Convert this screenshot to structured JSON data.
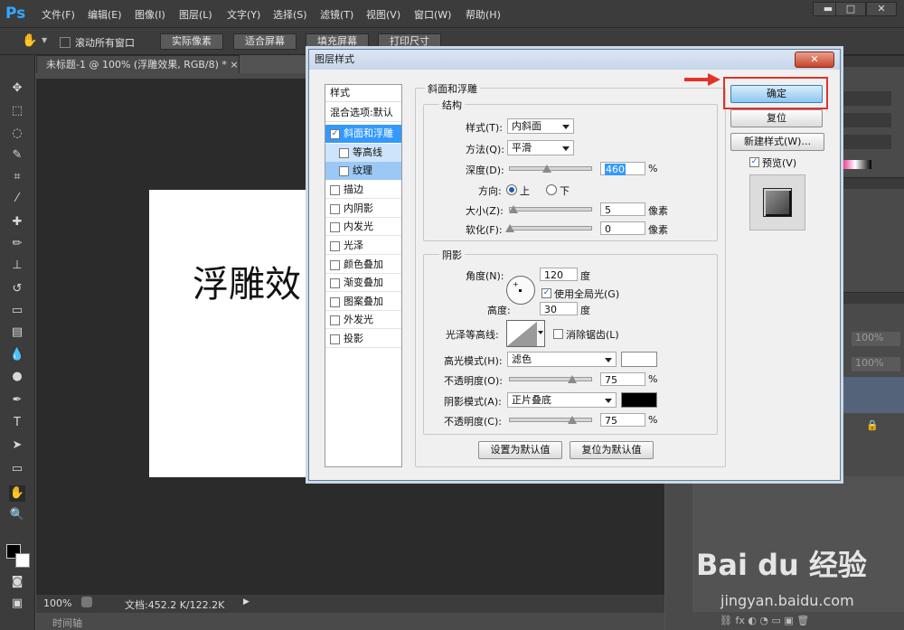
{
  "app": {
    "logo": "Ps"
  },
  "menu": [
    "文件(F)",
    "编辑(E)",
    "图像(I)",
    "图层(L)",
    "文字(Y)",
    "选择(S)",
    "滤镜(T)",
    "视图(V)",
    "窗口(W)",
    "帮助(H)"
  ],
  "window_controls": {
    "min": "▬",
    "max": "□",
    "close": "✕"
  },
  "options_bar": {
    "scroll_all": "滚动所有窗口",
    "buttons": [
      "实际像素",
      "适合屏幕",
      "填充屏幕",
      "打印尺寸"
    ]
  },
  "doc_tab": {
    "title": "未标题-1 @ 100% (浮雕效果, RGB/8) *",
    "close": "×"
  },
  "canvas_text": "浮雕效",
  "status": {
    "zoom": "100%",
    "doc_info": "文档:452.2 K/122.2K"
  },
  "timeline": "时间轴",
  "right_panel": {
    "opacity1": "100%",
    "opacity2": "100%"
  },
  "dialog": {
    "title": "图层样式",
    "close": "✕",
    "sidebar": {
      "header": "样式",
      "blend": "混合选项:默认",
      "items": [
        {
          "label": "斜面和浮雕",
          "checked": true,
          "active": true
        },
        {
          "label": "等高线",
          "checked": false,
          "sub": true
        },
        {
          "label": "纹理",
          "checked": false,
          "sub": true
        },
        {
          "label": "描边",
          "checked": false
        },
        {
          "label": "内阴影",
          "checked": false
        },
        {
          "label": "内发光",
          "checked": false
        },
        {
          "label": "光泽",
          "checked": false
        },
        {
          "label": "颜色叠加",
          "checked": false
        },
        {
          "label": "渐变叠加",
          "checked": false
        },
        {
          "label": "图案叠加",
          "checked": false
        },
        {
          "label": "外发光",
          "checked": false
        },
        {
          "label": "投影",
          "checked": false
        }
      ]
    },
    "bevel": {
      "section": "斜面和浮雕",
      "structure": "结构",
      "style_label": "样式(T):",
      "style_value": "内斜面",
      "method_label": "方法(Q):",
      "method_value": "平滑",
      "depth_label": "深度(D):",
      "depth_value": "460",
      "depth_unit": "%",
      "direction_label": "方向:",
      "up": "上",
      "down": "下",
      "size_label": "大小(Z):",
      "size_value": "5",
      "size_unit": "像素",
      "soften_label": "软化(F):",
      "soften_value": "0",
      "soften_unit": "像素"
    },
    "shading": {
      "section": "阴影",
      "angle_label": "角度(N):",
      "angle_value": "120",
      "angle_unit": "度",
      "global_light": "使用全局光(G)",
      "altitude_label": "高度:",
      "altitude_value": "30",
      "altitude_unit": "度",
      "gloss_label": "光泽等高线:",
      "antialias": "消除锯齿(L)",
      "highlight_mode_label": "高光模式(H):",
      "highlight_mode_value": "滤色",
      "highlight_color": "#ffffff",
      "highlight_opacity_label": "不透明度(O):",
      "highlight_opacity_value": "75",
      "highlight_opacity_unit": "%",
      "shadow_mode_label": "阴影模式(A):",
      "shadow_mode_value": "正片叠底",
      "shadow_color": "#000000",
      "shadow_opacity_label": "不透明度(C):",
      "shadow_opacity_value": "75",
      "shadow_opacity_unit": "%"
    },
    "bottom_buttons": {
      "set_default": "设置为默认值",
      "reset_default": "复位为默认值"
    },
    "buttons": {
      "ok": "确定",
      "reset": "复位",
      "new_style": "新建样式(W)...",
      "preview": "预览(V)"
    }
  },
  "watermark": {
    "brand": "Bai du 经验",
    "url": "jingyan.baidu.com"
  }
}
